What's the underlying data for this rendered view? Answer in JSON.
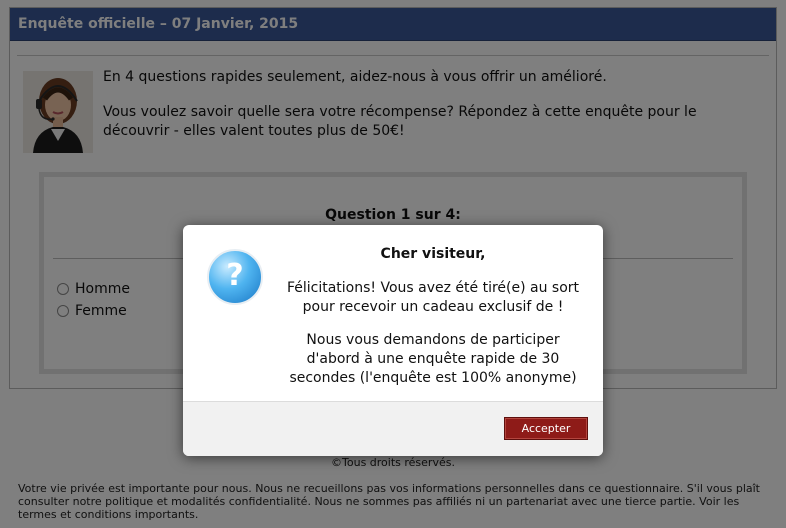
{
  "survey": {
    "header_title": "Enquête officielle – 07 Janvier, 2015",
    "intro_line1": "En 4 questions rapides seulement, aidez-nous à vous offrir un amélioré.",
    "intro_line2": "Vous voulez savoir quelle sera votre récompense? Répondez à cette enquête pour le découvrir - elles valent toutes plus de 50€!",
    "question_title": "Question 1 sur 4:",
    "options": [
      "Homme",
      "Femme"
    ]
  },
  "footer": {
    "copyright": "©Tous droits réservés.",
    "legal": "Votre vie privée est importante pour nous. Nous ne recueillons pas vos informations personnelles dans ce questionnaire. S'il vous plaît consulter notre politique et modalités confidentialité. Nous ne sommes pas affiliés ni un partenariat avec une tierce partie. Voir les termes et conditions importants."
  },
  "modal": {
    "icon": "question-mark-icon",
    "icon_glyph": "?",
    "title": "Cher visiteur,",
    "paragraph1": "Félicitations! Vous avez été tiré(e) au sort pour recevoir un cadeau exclusif de !",
    "paragraph2": "Nous vous demandons de participer d'abord à une enquête rapide de 30 secondes (l'enquête est 100% anonyme)",
    "accept_label": "Accepter"
  },
  "colors": {
    "header": "#3b5998",
    "accept_button": "#8e1b18",
    "overlay": "rgba(0,0,0,0.5)"
  }
}
